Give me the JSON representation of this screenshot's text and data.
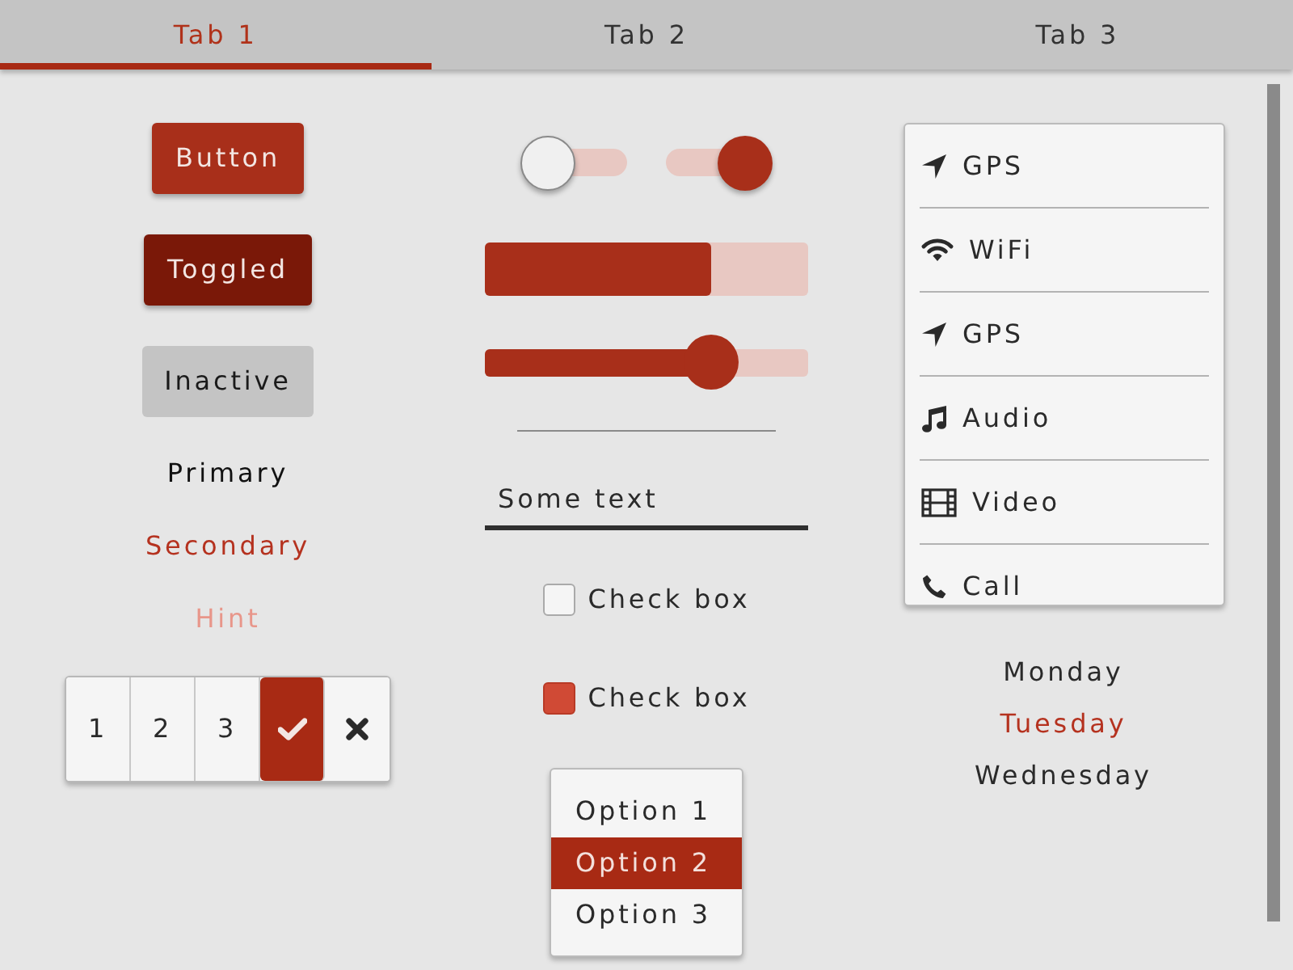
{
  "tabs": [
    {
      "label": "Tab 1",
      "selected": true
    },
    {
      "label": "Tab 2",
      "selected": false
    },
    {
      "label": "Tab 3",
      "selected": false
    }
  ],
  "buttons": [
    {
      "label": "Button",
      "toggled": false,
      "disabled": false
    },
    {
      "label": "Toggled",
      "toggled": true,
      "disabled": false
    },
    {
      "label": "Inactive",
      "toggled": false,
      "disabled": true
    }
  ],
  "labels": [
    {
      "text": "Primary",
      "kind": "primary"
    },
    {
      "text": "Secondary",
      "kind": "secondary"
    },
    {
      "text": "Hint",
      "kind": "hint"
    }
  ],
  "segmented": [
    {
      "kind": "text",
      "label": "1",
      "selected": false
    },
    {
      "kind": "text",
      "label": "2",
      "selected": false
    },
    {
      "kind": "text",
      "label": "3",
      "selected": false
    },
    {
      "kind": "check",
      "selected": true
    },
    {
      "kind": "cross",
      "selected": false
    }
  ],
  "switches": [
    {
      "on": false
    },
    {
      "on": true
    }
  ],
  "progress": {
    "level": 0.7
  },
  "slider": {
    "level": 0.7
  },
  "text_field": {
    "value": "Some text"
  },
  "checkboxes": [
    {
      "label": "Check box",
      "checked": false
    },
    {
      "label": "Check box",
      "checked": true
    }
  ],
  "dropdown_list": [
    {
      "label": "Option 1",
      "selected": false
    },
    {
      "label": "Option 2",
      "selected": true
    },
    {
      "label": "Option 3",
      "selected": false
    }
  ],
  "menu_list": [
    {
      "label": "GPS",
      "kind": "location"
    },
    {
      "label": "WiFi",
      "kind": "wifi"
    },
    {
      "label": "GPS",
      "kind": "location"
    },
    {
      "label": "Audio",
      "kind": "music"
    },
    {
      "label": "Video",
      "kind": "film"
    },
    {
      "label": "Call",
      "kind": "phone"
    }
  ],
  "days": [
    {
      "label": "Monday",
      "selected": false
    },
    {
      "label": "Tuesday",
      "selected": true
    },
    {
      "label": "Wednesday",
      "selected": false
    }
  ]
}
